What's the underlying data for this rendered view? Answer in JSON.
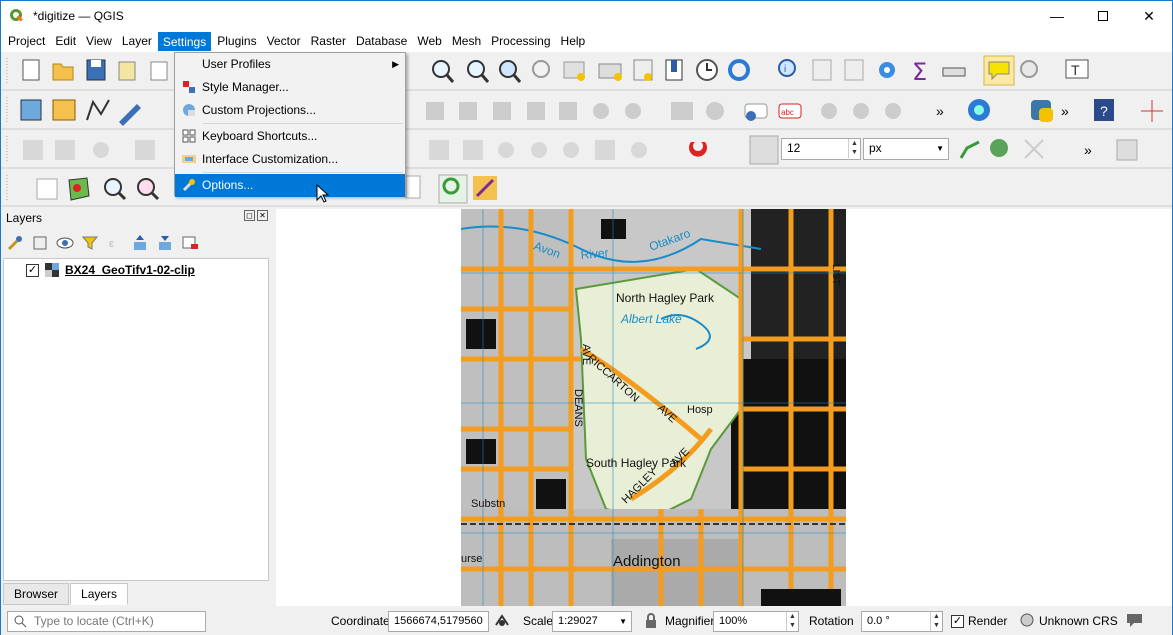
{
  "window": {
    "title": "*digitize — QGIS"
  },
  "menubar": {
    "items": [
      "Project",
      "Edit",
      "View",
      "Layer",
      "Settings",
      "Plugins",
      "Vector",
      "Raster",
      "Database",
      "Web",
      "Mesh",
      "Processing",
      "Help"
    ],
    "active": "Settings"
  },
  "settings_menu": {
    "items": [
      {
        "label": "User Profiles",
        "submenu": true
      },
      {
        "label": "Style Manager..."
      },
      {
        "label": "Custom Projections..."
      },
      {
        "label": "Keyboard Shortcuts..."
      },
      {
        "label": "Interface Customization..."
      },
      {
        "label": "Options...",
        "selected": true
      }
    ]
  },
  "toolbar": {
    "snap_tolerance": "12",
    "snap_unit": "px"
  },
  "layers_panel": {
    "title": "Layers",
    "layers": [
      {
        "name": "BX24_GeoTifv1-02-clip",
        "checked": true
      }
    ],
    "tabs": [
      "Browser",
      "Layers"
    ],
    "active_tab": "Layers"
  },
  "map": {
    "labels": [
      "Avon",
      "River",
      "Otakaro",
      "North Hagley Park",
      "Albert Lake",
      "AVE",
      "RICCARTON",
      "AVE",
      "Hosp",
      "DEANS",
      "South Hagley Park",
      "HAGLEY",
      "AVE",
      "Substn",
      "urse",
      "Addington",
      "LIST"
    ]
  },
  "statusbar": {
    "locate_placeholder": "Type to locate (Ctrl+K)",
    "coordinate_label": "Coordinate",
    "coordinate_value": "1566674,5179560",
    "scale_label": "Scale",
    "scale_value": "1:29027",
    "magnifier_label": "Magnifier",
    "magnifier_value": "100%",
    "rotation_label": "Rotation",
    "rotation_value": "0.0 °",
    "render_label": "Render",
    "render_checked": true,
    "crs_label": "Unknown CRS"
  },
  "colors": {
    "accent": "#0078d7",
    "road": "#f39c1e",
    "park": "#e8efd6",
    "water": "#1a8bc7"
  }
}
